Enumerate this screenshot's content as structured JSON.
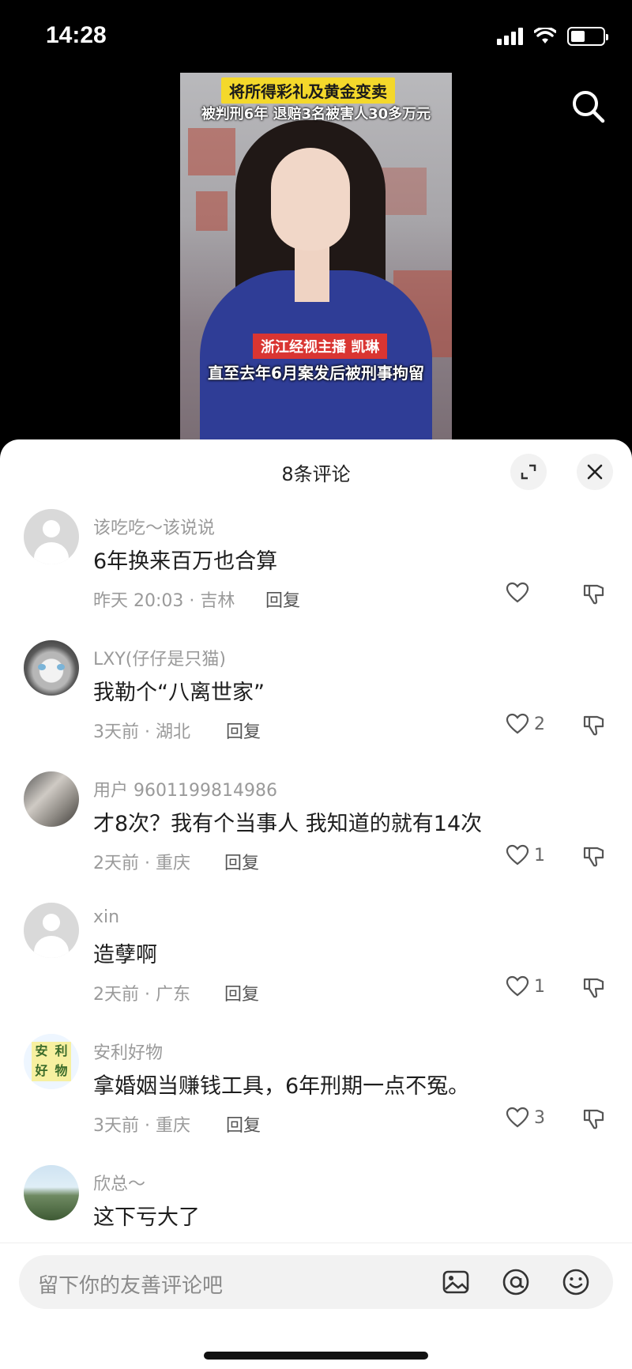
{
  "status_bar": {
    "time": "14:28",
    "battery_level": 0.45
  },
  "video": {
    "headline_1": "将所得彩礼及黄金变卖",
    "headline_2": "被判刑6年  退赔3名被害人30多万元",
    "name_tag": "浙江经视主播 凯琳",
    "subtitle": "直至去年6月案发后被刑事拘留",
    "search_icon": "search-icon"
  },
  "sheet": {
    "title": "8条评论",
    "expand_icon": "expand-icon",
    "close_icon": "close-icon"
  },
  "comments": [
    {
      "user": "该吃吃～该说说",
      "text": "6年换来百万也合算",
      "meta": "昨天 20:03 · 吉林",
      "reply": "回复",
      "likes": "",
      "avatar": "default"
    },
    {
      "user": "LXY(仔仔是只猫)",
      "text": "我勒个“八离世家”",
      "meta": "3天前 · 湖北",
      "reply": "回复",
      "likes": "2",
      "avatar": "cat"
    },
    {
      "user": "用户 9601199814986",
      "text": "才8次？我有个当事人 我知道的就有14次",
      "meta": "2天前 · 重庆",
      "reply": "回复",
      "likes": "1",
      "avatar": "photo"
    },
    {
      "user": "xin",
      "text": "造孽啊",
      "meta": "2天前 · 广东",
      "reply": "回复",
      "likes": "1",
      "avatar": "default"
    },
    {
      "user": "安利好物",
      "text": "拿婚姻当赚钱工具，6年刑期一点不冤。",
      "meta": "3天前 · 重庆",
      "reply": "回复",
      "likes": "3",
      "avatar": "badge",
      "badge_text": [
        "安",
        "利",
        "好",
        "物"
      ]
    },
    {
      "user": "欣总～",
      "text": "这下亏大了",
      "meta": "",
      "reply": "",
      "likes": "",
      "avatar": "land"
    }
  ],
  "input": {
    "placeholder": "留下你的友善评论吧",
    "icons": [
      "image-icon",
      "at-icon",
      "emoji-icon"
    ]
  }
}
